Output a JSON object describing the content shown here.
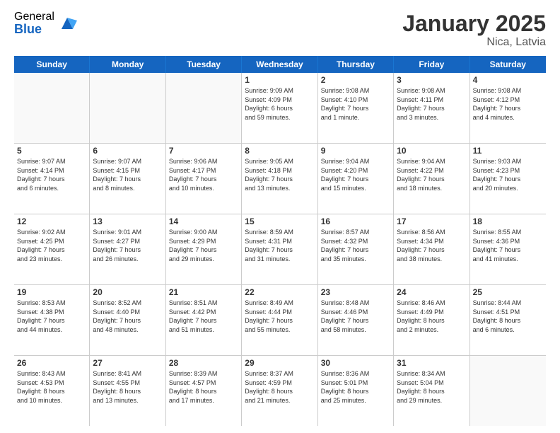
{
  "logo": {
    "general": "General",
    "blue": "Blue"
  },
  "title": "January 2025",
  "location": "Nica, Latvia",
  "days": [
    "Sunday",
    "Monday",
    "Tuesday",
    "Wednesday",
    "Thursday",
    "Friday",
    "Saturday"
  ],
  "weeks": [
    [
      {
        "day": "",
        "text": "",
        "empty": true
      },
      {
        "day": "",
        "text": "",
        "empty": true
      },
      {
        "day": "",
        "text": "",
        "empty": true
      },
      {
        "day": "1",
        "text": "Sunrise: 9:09 AM\nSunset: 4:09 PM\nDaylight: 6 hours\nand 59 minutes.",
        "empty": false
      },
      {
        "day": "2",
        "text": "Sunrise: 9:08 AM\nSunset: 4:10 PM\nDaylight: 7 hours\nand 1 minute.",
        "empty": false
      },
      {
        "day": "3",
        "text": "Sunrise: 9:08 AM\nSunset: 4:11 PM\nDaylight: 7 hours\nand 3 minutes.",
        "empty": false
      },
      {
        "day": "4",
        "text": "Sunrise: 9:08 AM\nSunset: 4:12 PM\nDaylight: 7 hours\nand 4 minutes.",
        "empty": false
      }
    ],
    [
      {
        "day": "5",
        "text": "Sunrise: 9:07 AM\nSunset: 4:14 PM\nDaylight: 7 hours\nand 6 minutes.",
        "empty": false
      },
      {
        "day": "6",
        "text": "Sunrise: 9:07 AM\nSunset: 4:15 PM\nDaylight: 7 hours\nand 8 minutes.",
        "empty": false
      },
      {
        "day": "7",
        "text": "Sunrise: 9:06 AM\nSunset: 4:17 PM\nDaylight: 7 hours\nand 10 minutes.",
        "empty": false
      },
      {
        "day": "8",
        "text": "Sunrise: 9:05 AM\nSunset: 4:18 PM\nDaylight: 7 hours\nand 13 minutes.",
        "empty": false
      },
      {
        "day": "9",
        "text": "Sunrise: 9:04 AM\nSunset: 4:20 PM\nDaylight: 7 hours\nand 15 minutes.",
        "empty": false
      },
      {
        "day": "10",
        "text": "Sunrise: 9:04 AM\nSunset: 4:22 PM\nDaylight: 7 hours\nand 18 minutes.",
        "empty": false
      },
      {
        "day": "11",
        "text": "Sunrise: 9:03 AM\nSunset: 4:23 PM\nDaylight: 7 hours\nand 20 minutes.",
        "empty": false
      }
    ],
    [
      {
        "day": "12",
        "text": "Sunrise: 9:02 AM\nSunset: 4:25 PM\nDaylight: 7 hours\nand 23 minutes.",
        "empty": false
      },
      {
        "day": "13",
        "text": "Sunrise: 9:01 AM\nSunset: 4:27 PM\nDaylight: 7 hours\nand 26 minutes.",
        "empty": false
      },
      {
        "day": "14",
        "text": "Sunrise: 9:00 AM\nSunset: 4:29 PM\nDaylight: 7 hours\nand 29 minutes.",
        "empty": false
      },
      {
        "day": "15",
        "text": "Sunrise: 8:59 AM\nSunset: 4:31 PM\nDaylight: 7 hours\nand 31 minutes.",
        "empty": false
      },
      {
        "day": "16",
        "text": "Sunrise: 8:57 AM\nSunset: 4:32 PM\nDaylight: 7 hours\nand 35 minutes.",
        "empty": false
      },
      {
        "day": "17",
        "text": "Sunrise: 8:56 AM\nSunset: 4:34 PM\nDaylight: 7 hours\nand 38 minutes.",
        "empty": false
      },
      {
        "day": "18",
        "text": "Sunrise: 8:55 AM\nSunset: 4:36 PM\nDaylight: 7 hours\nand 41 minutes.",
        "empty": false
      }
    ],
    [
      {
        "day": "19",
        "text": "Sunrise: 8:53 AM\nSunset: 4:38 PM\nDaylight: 7 hours\nand 44 minutes.",
        "empty": false
      },
      {
        "day": "20",
        "text": "Sunrise: 8:52 AM\nSunset: 4:40 PM\nDaylight: 7 hours\nand 48 minutes.",
        "empty": false
      },
      {
        "day": "21",
        "text": "Sunrise: 8:51 AM\nSunset: 4:42 PM\nDaylight: 7 hours\nand 51 minutes.",
        "empty": false
      },
      {
        "day": "22",
        "text": "Sunrise: 8:49 AM\nSunset: 4:44 PM\nDaylight: 7 hours\nand 55 minutes.",
        "empty": false
      },
      {
        "day": "23",
        "text": "Sunrise: 8:48 AM\nSunset: 4:46 PM\nDaylight: 7 hours\nand 58 minutes.",
        "empty": false
      },
      {
        "day": "24",
        "text": "Sunrise: 8:46 AM\nSunset: 4:49 PM\nDaylight: 8 hours\nand 2 minutes.",
        "empty": false
      },
      {
        "day": "25",
        "text": "Sunrise: 8:44 AM\nSunset: 4:51 PM\nDaylight: 8 hours\nand 6 minutes.",
        "empty": false
      }
    ],
    [
      {
        "day": "26",
        "text": "Sunrise: 8:43 AM\nSunset: 4:53 PM\nDaylight: 8 hours\nand 10 minutes.",
        "empty": false
      },
      {
        "day": "27",
        "text": "Sunrise: 8:41 AM\nSunset: 4:55 PM\nDaylight: 8 hours\nand 13 minutes.",
        "empty": false
      },
      {
        "day": "28",
        "text": "Sunrise: 8:39 AM\nSunset: 4:57 PM\nDaylight: 8 hours\nand 17 minutes.",
        "empty": false
      },
      {
        "day": "29",
        "text": "Sunrise: 8:37 AM\nSunset: 4:59 PM\nDaylight: 8 hours\nand 21 minutes.",
        "empty": false
      },
      {
        "day": "30",
        "text": "Sunrise: 8:36 AM\nSunset: 5:01 PM\nDaylight: 8 hours\nand 25 minutes.",
        "empty": false
      },
      {
        "day": "31",
        "text": "Sunrise: 8:34 AM\nSunset: 5:04 PM\nDaylight: 8 hours\nand 29 minutes.",
        "empty": false
      },
      {
        "day": "",
        "text": "",
        "empty": true
      }
    ]
  ]
}
